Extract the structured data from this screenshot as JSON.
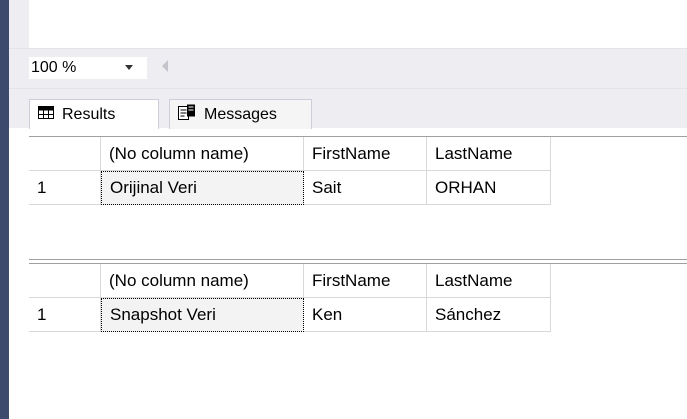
{
  "zoom": {
    "value": "100 %"
  },
  "tabs": {
    "results": "Results",
    "messages": "Messages"
  },
  "grids": [
    {
      "columns": [
        "(No column name)",
        "FirstName",
        "LastName"
      ],
      "rows": [
        {
          "num": "1",
          "cells": [
            "Orijinal Veri",
            "Sait",
            "ORHAN"
          ]
        }
      ]
    },
    {
      "columns": [
        "(No column name)",
        "FirstName",
        "LastName"
      ],
      "rows": [
        {
          "num": "1",
          "cells": [
            "Snapshot Veri",
            "Ken",
            "Sánchez"
          ]
        }
      ]
    }
  ],
  "icons": {
    "results": "grid-icon",
    "messages": "messages-icon",
    "zoom_dropdown": "chevron-down-icon",
    "scroll_left": "scroll-left-arrow-icon"
  },
  "colors": {
    "sidebar": "#3c4a6e",
    "chrome": "#eeeef2",
    "grid_line": "#d8d8d8"
  }
}
